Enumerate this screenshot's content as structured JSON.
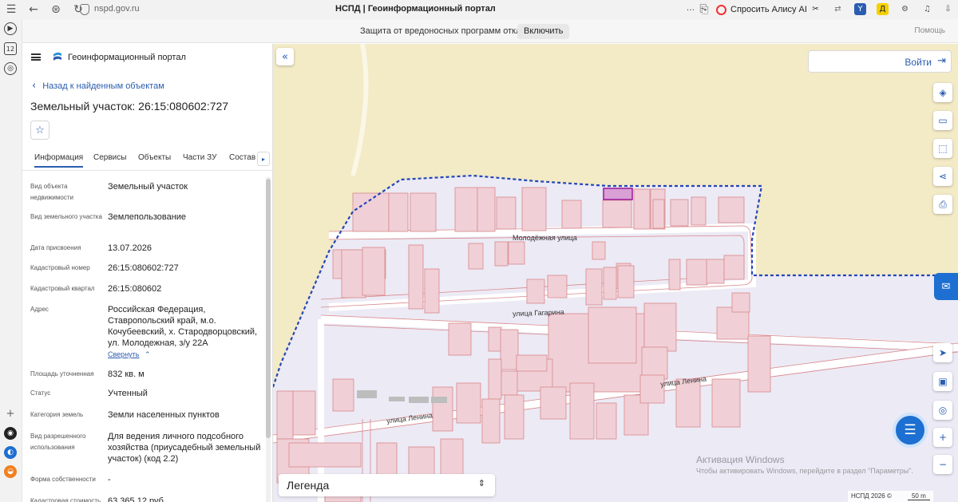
{
  "browser": {
    "url": "nspd.gov.ru",
    "tab_title": "НСПД | Геоинформационный портал",
    "alice_label": "Спросить Алису AI",
    "infobar": {
      "message": "Защита от вредоносных программ отключена",
      "enable_label": "Включить",
      "help_label": "Помощь"
    },
    "sidebar_badge": "12"
  },
  "panel": {
    "portal_name": "Геоинформационный портал",
    "back_label": "Назад к найденным объектам",
    "title": "Земельный участок: 26:15:080602:727",
    "tabs": [
      {
        "label": "Информация",
        "active": true
      },
      {
        "label": "Сервисы"
      },
      {
        "label": "Объекты"
      },
      {
        "label": "Части ЗУ"
      },
      {
        "label": "Состав"
      }
    ],
    "properties": [
      {
        "label": "Вид объекта недвижимости",
        "value": "Земельный участок"
      },
      {
        "label": "Вид земельного участка",
        "value": "Землепользование"
      },
      {
        "label": "Дата присвоения",
        "value": "13.07.2026"
      },
      {
        "label": "Кадастровый номер",
        "value": "26:15:080602:727"
      },
      {
        "label": "Кадастровый квартал",
        "value": "26:15:080602"
      },
      {
        "label": "Адрес",
        "value": "Российская Федерация, Ставропольский край, м.о. Кочубеевский, х. Стародворцовский, ул. Молодежная, з/у 22А"
      },
      {
        "label": "Площадь уточненная",
        "value": "832 кв. м"
      },
      {
        "label": "Статус",
        "value": "Учтенный"
      },
      {
        "label": "Категория земель",
        "value": "Земли населенных пунктов"
      },
      {
        "label": "Вид разрешенного использования",
        "value": "Для ведения личного подсобного хозяйства (приусадебный земельный участок) (код 2.2)"
      },
      {
        "label": "Форма собственности",
        "value": "-"
      },
      {
        "label": "Кадастровая стоимость",
        "value": "63 365,12 руб."
      }
    ],
    "collapse_label": "Свернуть"
  },
  "map": {
    "login_label": "Войти",
    "legend_label": "Легенда",
    "streets": [
      "Молодёжная улица",
      "улица Гагарина",
      "улица Ленина",
      "улица Ленина"
    ],
    "watermark_title": "Активация Windows",
    "watermark_text": "Чтобы активировать Windows, перейдите в раздел \"Параметры\".",
    "attribution": "НСПД 2026 ©",
    "scale_label": "50 m",
    "colors": {
      "territory": "#f3eac6",
      "settlement": "#eceaf5",
      "parcel_stroke": "#d9888c",
      "boundary": "#2446b8",
      "selected": "#a0219c"
    }
  }
}
